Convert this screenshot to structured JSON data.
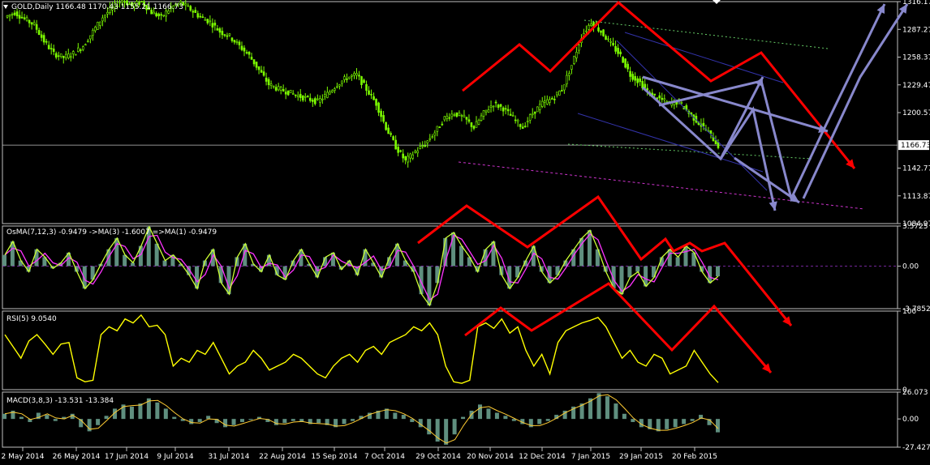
{
  "colors": {
    "background": "#000000",
    "grid": "#c0c0c0",
    "candle": "#7cfc00",
    "price_line": "#c0c0c0",
    "osma_hist": "#5f8f7f",
    "osma_fast": "#ccff33",
    "osma_slow": "#ff33ff",
    "rsi": "#ffff00",
    "macd_hist": "#5f8f7f",
    "macd_signal": "#ffcc33",
    "annot_red": "#ff0000",
    "annot_purple": "#8888cc",
    "channel_blue": "#3333aa",
    "channel_magenta": "#cc33cc",
    "channel_green": "#66cc66"
  },
  "chart_data": [
    {
      "type": "candlestick",
      "title": "GOLD,Daily  1166.48 1170.43 1155.21 1166.73",
      "symbol": "GOLD,Daily",
      "ohlc": {
        "open": 1166.48,
        "high": 1170.43,
        "low": 1155.21,
        "close": 1166.73
      },
      "current_price_label": "1166.73",
      "y_ticks": [
        "1316.17",
        "1287.27",
        "1258.37",
        "1229.47",
        "1200.57",
        "1142.77",
        "1113.87",
        "1084.97"
      ],
      "ylim": [
        1084.97,
        1316.17
      ],
      "x_ticks": [
        "2 May 2014",
        "26 May 2014",
        "17 Jun 2014",
        "9 Jul 2014",
        "31 Jul 2014",
        "22 Aug 2014",
        "15 Sep 2014",
        "7 Oct 2014",
        "29 Oct 2014",
        "20 Nov 2014",
        "12 Dec 2014",
        "7 Jan 2015",
        "29 Jan 2015",
        "20 Feb 2015"
      ],
      "approx_close_path": [
        [
          0,
          1300
        ],
        [
          4,
          1305
        ],
        [
          8,
          1298
        ],
        [
          12,
          1292
        ],
        [
          16,
          1275
        ],
        [
          20,
          1262
        ],
        [
          24,
          1258
        ],
        [
          28,
          1262
        ],
        [
          32,
          1270
        ],
        [
          36,
          1285
        ],
        [
          40,
          1300
        ],
        [
          44,
          1310
        ],
        [
          48,
          1318
        ],
        [
          52,
          1312
        ],
        [
          56,
          1316
        ],
        [
          60,
          1305
        ],
        [
          64,
          1300
        ],
        [
          68,
          1310
        ],
        [
          72,
          1315
        ],
        [
          76,
          1308
        ],
        [
          80,
          1300
        ],
        [
          84,
          1295
        ],
        [
          88,
          1285
        ],
        [
          92,
          1280
        ],
        [
          96,
          1270
        ],
        [
          100,
          1260
        ],
        [
          104,
          1245
        ],
        [
          108,
          1230
        ],
        [
          112,
          1225
        ],
        [
          116,
          1222
        ],
        [
          120,
          1218
        ],
        [
          124,
          1215
        ],
        [
          128,
          1212
        ],
        [
          132,
          1220
        ],
        [
          136,
          1230
        ],
        [
          140,
          1237
        ],
        [
          144,
          1240
        ],
        [
          148,
          1225
        ],
        [
          152,
          1210
        ],
        [
          156,
          1185
        ],
        [
          160,
          1165
        ],
        [
          164,
          1150
        ],
        [
          168,
          1160
        ],
        [
          172,
          1168
        ],
        [
          176,
          1180
        ],
        [
          180,
          1195
        ],
        [
          184,
          1200
        ],
        [
          188,
          1195
        ],
        [
          192,
          1185
        ],
        [
          196,
          1200
        ],
        [
          200,
          1210
        ],
        [
          204,
          1205
        ],
        [
          208,
          1195
        ],
        [
          212,
          1185
        ],
        [
          216,
          1200
        ],
        [
          220,
          1210
        ],
        [
          224,
          1215
        ],
        [
          228,
          1225
        ],
        [
          232,
          1250
        ],
        [
          236,
          1280
        ],
        [
          240,
          1295
        ],
        [
          244,
          1285
        ],
        [
          248,
          1272
        ],
        [
          252,
          1260
        ],
        [
          256,
          1240
        ],
        [
          260,
          1232
        ],
        [
          264,
          1220
        ],
        [
          268,
          1215
        ],
        [
          272,
          1210
        ],
        [
          276,
          1212
        ],
        [
          280,
          1200
        ],
        [
          284,
          1190
        ],
        [
          288,
          1180
        ],
        [
          292,
          1166
        ]
      ]
    },
    {
      "type": "line",
      "title": "OsMA(7,12,3) -0.9479  ->MA(3) -1.6007  =>MA(1) -0.9479",
      "y_ticks": [
        "3.5725",
        "0.00",
        "-3.7852"
      ],
      "ylim": [
        -3.7852,
        3.5725
      ],
      "series": [
        {
          "values": [
            1,
            2.2,
            0.5,
            -0.5,
            1.5,
            0.8,
            -0.2,
            0.3,
            1.2,
            -0.5,
            -2.0,
            -1.2,
            0.2,
            1.5,
            2.5,
            1.0,
            0.3,
            1.8,
            3.5,
            2.0,
            0.5,
            1.0,
            0.2,
            -0.8,
            -2.0,
            0.5,
            1.5,
            -1.5,
            -2.5,
            0.8,
            2.0,
            0.2,
            -0.5,
            1.0,
            -0.8,
            -1.2,
            0.5,
            1.5,
            0.2,
            -1.0,
            0.8,
            1.2,
            -0.3,
            0.5,
            -0.8,
            1.5,
            0.3,
            -1.0,
            0.8,
            2.0,
            0.5,
            -0.5,
            -2.5,
            -3.5,
            -1.5,
            2.5,
            3.0,
            1.8,
            0.8,
            -0.5,
            1.5,
            2.2,
            -0.8,
            -2.0,
            -1.0,
            0.5,
            1.8,
            -0.5,
            -1.5,
            -0.8,
            0.5,
            1.5,
            2.5,
            3.2,
            1.5,
            -0.5,
            -2.0,
            -2.5,
            -1.0,
            -0.5,
            -1.8,
            -1.0,
            0.8,
            1.5,
            0.8,
            1.8,
            1.2,
            -0.5,
            -1.5,
            -0.9
          ]
        }
      ]
    },
    {
      "type": "line",
      "title": "RSI(5) 9.0540",
      "y_ticks": [
        "100",
        "0"
      ],
      "ylim": [
        0,
        100
      ],
      "series": [
        {
          "values": [
            70,
            55,
            40,
            62,
            70,
            58,
            45,
            58,
            60,
            15,
            10,
            12,
            70,
            80,
            75,
            90,
            85,
            95,
            80,
            82,
            70,
            30,
            40,
            35,
            50,
            45,
            60,
            40,
            20,
            30,
            35,
            50,
            40,
            25,
            30,
            35,
            45,
            40,
            30,
            20,
            15,
            30,
            40,
            45,
            35,
            50,
            55,
            45,
            60,
            65,
            70,
            80,
            75,
            85,
            70,
            30,
            10,
            8,
            12,
            80,
            85,
            78,
            90,
            72,
            80,
            50,
            30,
            45,
            20,
            60,
            75,
            80,
            85,
            88,
            92,
            80,
            60,
            40,
            50,
            35,
            30,
            45,
            40,
            20,
            25,
            30,
            50,
            35,
            20,
            9
          ]
        }
      ]
    },
    {
      "type": "bar",
      "title": "MACD(3,8,3) -13.531 -13.384",
      "y_ticks": [
        "26.073",
        "0.00",
        "-27.427"
      ],
      "ylim": [
        -27.427,
        26.073
      ],
      "series": [
        {
          "values": [
            5,
            8,
            2,
            -3,
            6,
            4,
            -2,
            2,
            5,
            -8,
            -12,
            -6,
            3,
            10,
            14,
            12,
            15,
            20,
            16,
            10,
            2,
            -2,
            -5,
            -3,
            3,
            -4,
            -8,
            -6,
            -3,
            -1,
            2,
            -3,
            -6,
            -4,
            -2,
            -3,
            -5,
            -4,
            -6,
            -8,
            -5,
            -2,
            3,
            6,
            8,
            10,
            6,
            4,
            -3,
            -8,
            -15,
            -22,
            -25,
            -15,
            2,
            8,
            14,
            10,
            6,
            3,
            -2,
            -5,
            -8,
            -5,
            -2,
            4,
            8,
            12,
            15,
            20,
            25,
            22,
            15,
            5,
            -3,
            -8,
            -10,
            -12,
            -10,
            -8,
            -5,
            -2,
            4,
            -6,
            -13
          ]
        }
      ]
    }
  ]
}
